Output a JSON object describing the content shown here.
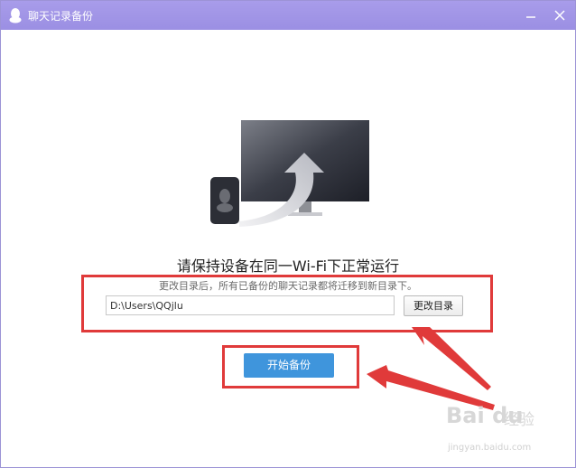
{
  "window": {
    "title": "聊天记录备份",
    "app_icon": "qq-penguin-icon",
    "buttons": [
      "minimize-icon",
      "close-icon"
    ],
    "title_bar_color": "#a095e6"
  },
  "main": {
    "illustration": "phone-to-monitor-transfer-icon",
    "heading": "请保持设备在同一Wi-Fi下正常运行",
    "subtext": "更改目录后，所有已备份的聊天记录都将迁移到新目录下。",
    "path_value": "D:\\Users\\QQjlu",
    "change_button": "更改目录",
    "start_button": "开始备份",
    "accent_color": "#3f95dc"
  },
  "annotations": {
    "highlight_color": "#e03a3a"
  },
  "watermark": {
    "logo": "Bai du",
    "sub": "经验",
    "url": "jingyan.baidu.com"
  }
}
